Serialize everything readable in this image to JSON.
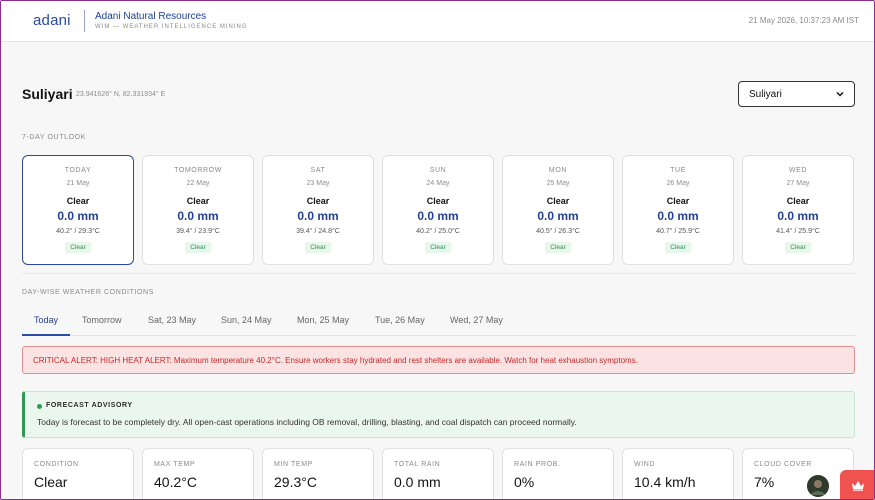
{
  "header": {
    "logo": "adani",
    "brand_title": "Adani Natural Resources",
    "brand_subtitle": "WIM — WEATHER INTELLIGENCE MINING",
    "datetime": "21 May 2026, 10:37:23 AM IST"
  },
  "location": {
    "name": "Suliyari",
    "coords": "23.941626° N, 82.331934° E",
    "select_value": "Suliyari"
  },
  "outlook": {
    "label": "7-DAY OUTLOOK",
    "days": [
      {
        "name": "TODAY",
        "date": "21 May",
        "condition": "Clear",
        "rain": "0.0 mm",
        "temp": "40.2° / 29.3°C",
        "badge": "Clear"
      },
      {
        "name": "TOMORROW",
        "date": "22 May",
        "condition": "Clear",
        "rain": "0.0 mm",
        "temp": "39.4° / 23.9°C",
        "badge": "Clear"
      },
      {
        "name": "SAT",
        "date": "23 May",
        "condition": "Clear",
        "rain": "0.0 mm",
        "temp": "39.4° / 24.8°C",
        "badge": "Clear"
      },
      {
        "name": "SUN",
        "date": "24 May",
        "condition": "Clear",
        "rain": "0.0 mm",
        "temp": "40.2° / 25.0°C",
        "badge": "Clear"
      },
      {
        "name": "MON",
        "date": "25 May",
        "condition": "Clear",
        "rain": "0.0 mm",
        "temp": "40.5° / 26.3°C",
        "badge": "Clear"
      },
      {
        "name": "TUE",
        "date": "26 May",
        "condition": "Clear",
        "rain": "0.0 mm",
        "temp": "40.7° / 25.9°C",
        "badge": "Clear"
      },
      {
        "name": "WED",
        "date": "27 May",
        "condition": "Clear",
        "rain": "0.0 mm",
        "temp": "41.4° / 25.9°C",
        "badge": "Clear"
      }
    ]
  },
  "daywise": {
    "label": "DAY-WISE WEATHER CONDITIONS",
    "tabs": [
      "Today",
      "Tomorrow",
      "Sat, 23 May",
      "Sun, 24 May",
      "Mon, 25 May",
      "Tue, 26 May",
      "Wed, 27 May"
    ]
  },
  "alert": {
    "text": "CRITICAL ALERT: HIGH HEAT ALERT: Maximum temperature 40.2°C. Ensure workers stay hydrated and rest shelters are available. Watch for heat exhaustion symptoms."
  },
  "advisory": {
    "title": "FORECAST ADVISORY",
    "text": "Today is forecast to be completely dry. All open-cast operations including OB removal, drilling, blasting, and coal dispatch can proceed normally."
  },
  "metrics": [
    {
      "label": "CONDITION",
      "value": "Clear"
    },
    {
      "label": "MAX TEMP",
      "value": "40.2°C"
    },
    {
      "label": "MIN TEMP",
      "value": "29.3°C"
    },
    {
      "label": "TOTAL RAIN",
      "value": "0.0 mm"
    },
    {
      "label": "RAIN PROB.",
      "value": "0%"
    },
    {
      "label": "WIND",
      "value": "10.4 km/h"
    },
    {
      "label": "CLOUD COVER",
      "value": "7%"
    }
  ],
  "colors": {
    "brand": "#2b4aa6",
    "alert": "#c62828",
    "success": "#2f9a52",
    "fab": "#f0524f"
  }
}
